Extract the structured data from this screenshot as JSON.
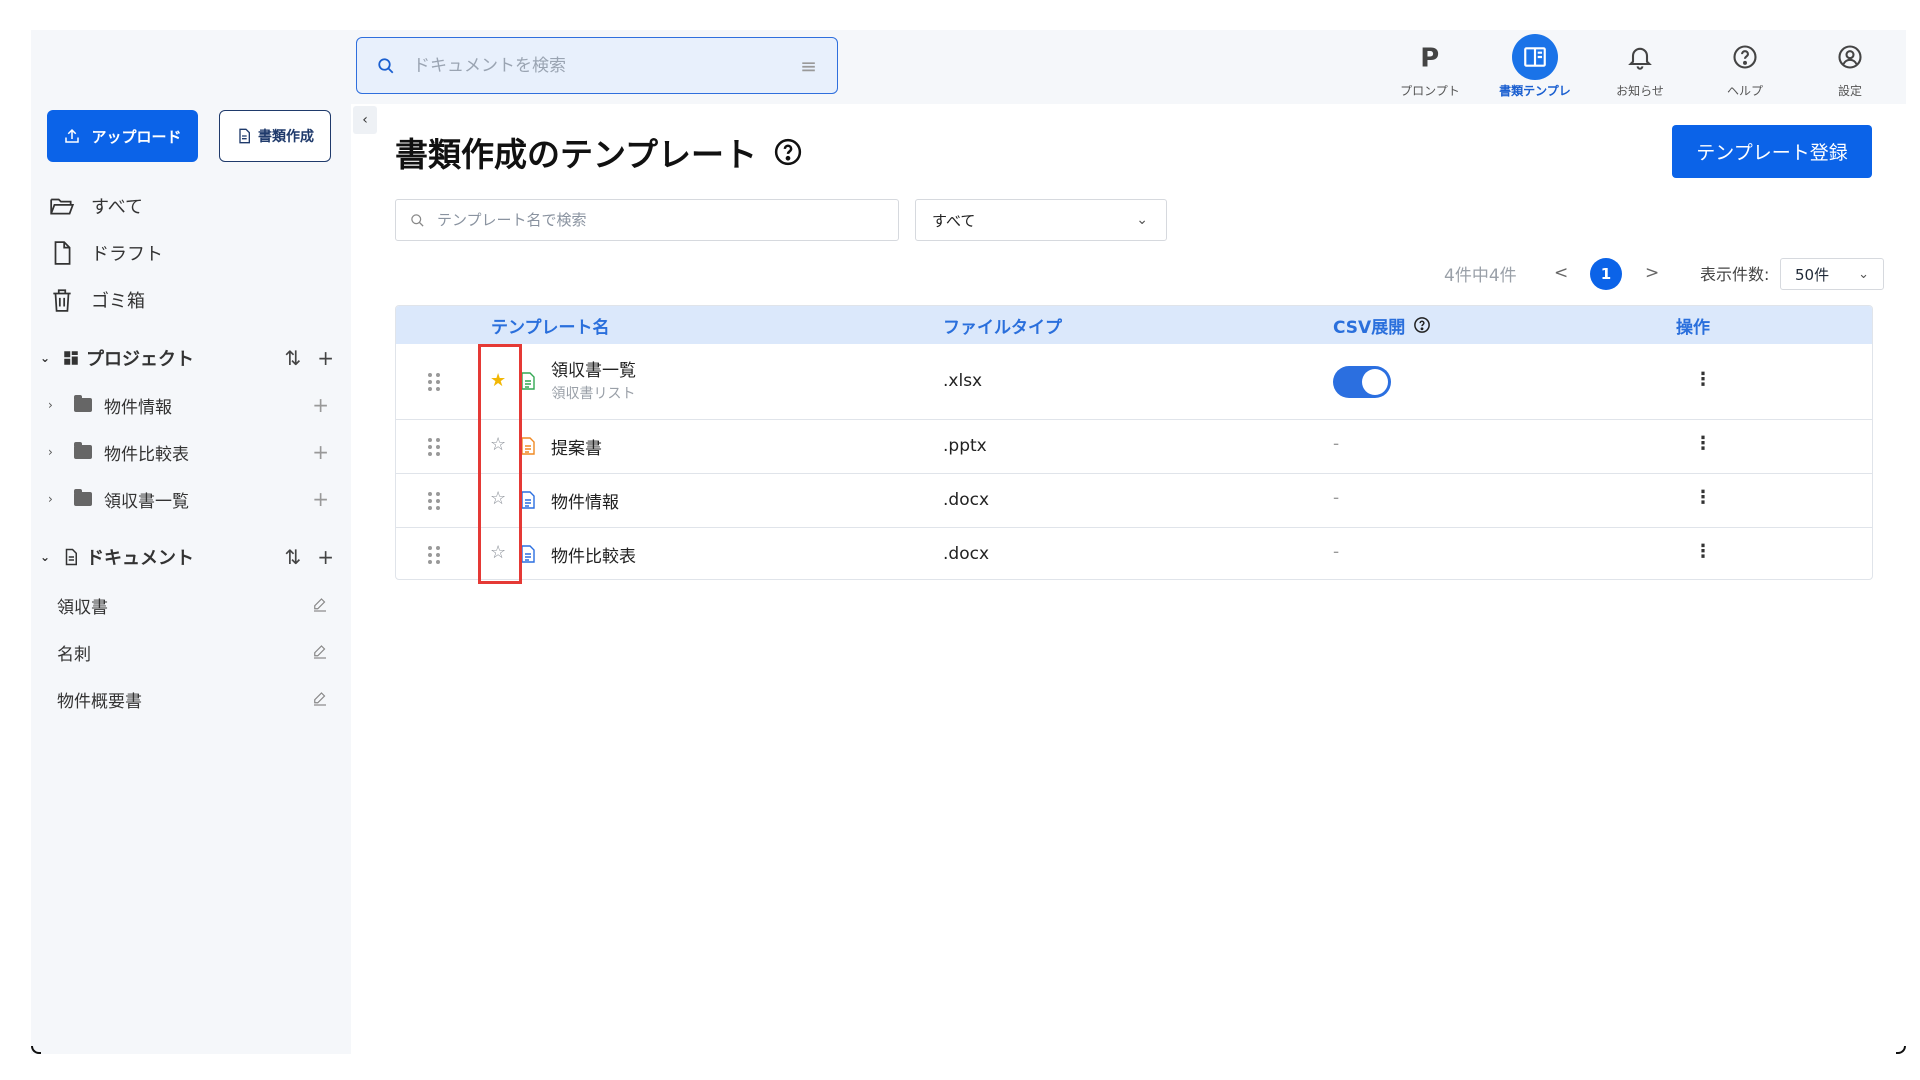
{
  "sidebar": {
    "upload_label": "アップロード",
    "create_label": "書類作成",
    "nav": [
      {
        "label": "すべて",
        "icon": "folder-open-icon"
      },
      {
        "label": "ドラフト",
        "icon": "file-icon"
      },
      {
        "label": "ゴミ箱",
        "icon": "trash-icon"
      }
    ],
    "projects": {
      "title": "プロジェクト",
      "items": [
        "物件情報",
        "物件比較表",
        "領収書一覧"
      ]
    },
    "documents": {
      "title": "ドキュメント",
      "items": [
        "領収書",
        "名刺",
        "物件概要書"
      ]
    }
  },
  "header": {
    "search_placeholder": "ドキュメントを検索",
    "nav": [
      {
        "label": "プロンプト",
        "icon": "prompt-p-icon",
        "active": false
      },
      {
        "label": "書類テンプレ",
        "icon": "template-icon",
        "active": true
      },
      {
        "label": "お知らせ",
        "icon": "bell-icon",
        "active": false
      },
      {
        "label": "ヘルプ",
        "icon": "help-circle-icon",
        "active": false
      },
      {
        "label": "設定",
        "icon": "user-circle-icon",
        "active": false
      }
    ]
  },
  "main": {
    "title": "書類作成のテンプレート",
    "register_label": "テンプレート登録",
    "search_placeholder": "テンプレート名で検索",
    "filter_value": "すべて",
    "pagination": {
      "count_text": "4件中4件",
      "prev": "<",
      "page": "1",
      "next": ">",
      "per_page_label": "表示件数:",
      "per_page_value": "50件"
    },
    "table": {
      "headers": {
        "name": "テンプレート名",
        "filetype": "ファイルタイプ",
        "csv": "CSV展開",
        "ops": "操作"
      },
      "rows": [
        {
          "name": "領収書一覧",
          "sub": "領収書リスト",
          "filetype": ".xlsx",
          "csv": "on",
          "starred": true,
          "file_color": "#34a853"
        },
        {
          "name": "提案書",
          "sub": "",
          "filetype": ".pptx",
          "csv": "-",
          "starred": false,
          "file_color": "#f08a24"
        },
        {
          "name": "物件情報",
          "sub": "",
          "filetype": ".docx",
          "csv": "-",
          "starred": false,
          "file_color": "#2b6fe0"
        },
        {
          "name": "物件比較表",
          "sub": "",
          "filetype": ".docx",
          "csv": "-",
          "starred": false,
          "file_color": "#2b6fe0"
        }
      ],
      "star_filled": "★",
      "star_empty": "☆",
      "kebab": "⋮"
    }
  },
  "colors": {
    "accent": "#0b63e8",
    "highlight": "#e53935",
    "star": "#f2b705"
  }
}
